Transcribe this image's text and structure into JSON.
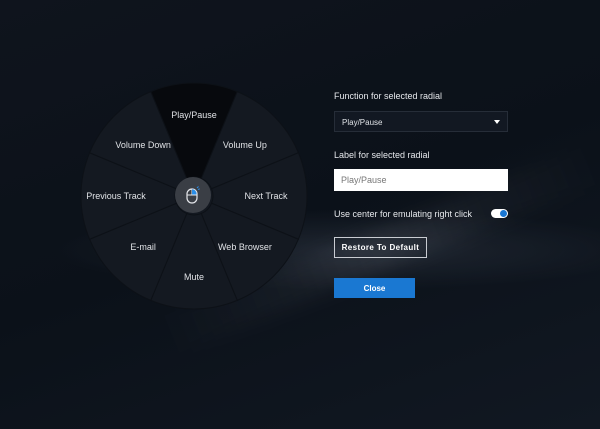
{
  "radial": {
    "segments": [
      {
        "label": "Play/Pause",
        "selected": true
      },
      {
        "label": "Volume Up"
      },
      {
        "label": "Next Track"
      },
      {
        "label": "Web Browser"
      },
      {
        "label": "Mute"
      },
      {
        "label": "E-mail"
      },
      {
        "label": "Previous Track"
      },
      {
        "label": "Volume Down"
      }
    ],
    "center_icon": "mouse-icon"
  },
  "panel": {
    "function_label": "Function for selected radial",
    "function_value": "Play/Pause",
    "label_label": "Label for selected radial",
    "label_value": "Play/Pause",
    "toggle_label": "Use center for emulating right click",
    "toggle_on": true,
    "restore_label": "Restore To Default",
    "close_label": "Close"
  },
  "colors": {
    "accent": "#1a78d2"
  }
}
